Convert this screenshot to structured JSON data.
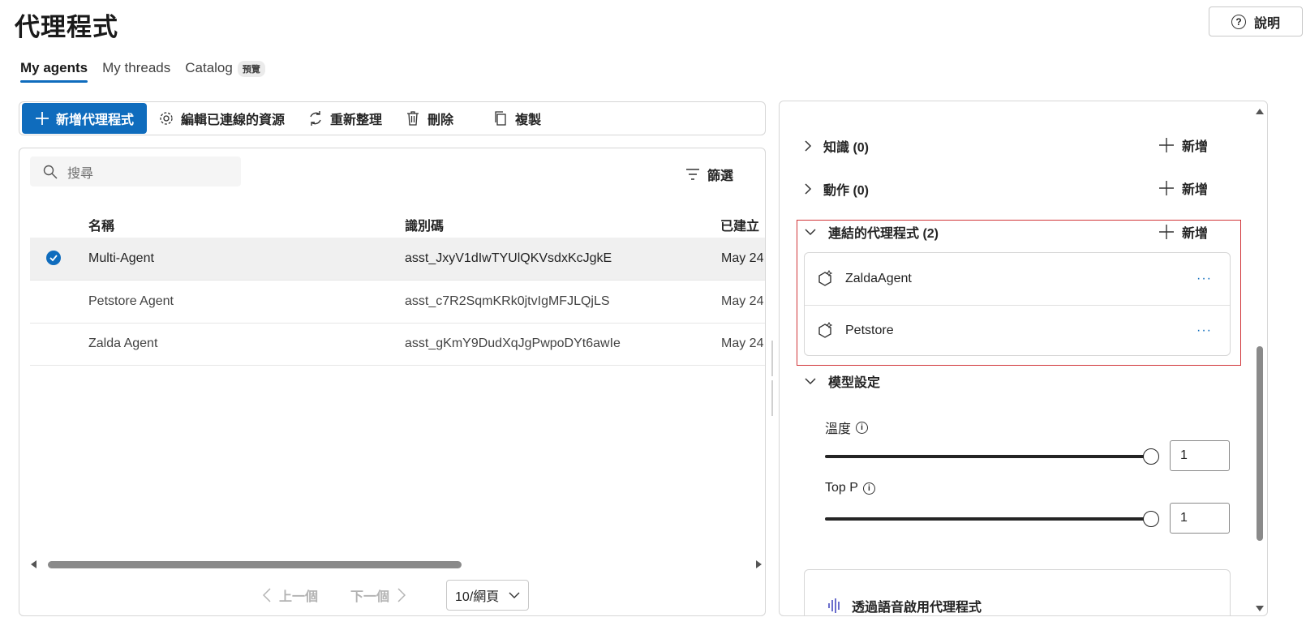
{
  "page": {
    "title": "代理程式",
    "help_label": "說明"
  },
  "tabs": [
    {
      "label": "My agents",
      "active": true
    },
    {
      "label": "My threads",
      "active": false
    },
    {
      "label": "Catalog",
      "active": false,
      "badge": "預覽"
    }
  ],
  "toolbar": {
    "new_agent": "新增代理程式",
    "edit_resources": "編輯已連線的資源",
    "refresh": "重新整理",
    "delete": "刪除",
    "copy": "複製"
  },
  "list": {
    "search_placeholder": "搜尋",
    "filter_label": "篩選",
    "columns": [
      "名稱",
      "識別碼",
      "已建立"
    ],
    "rows": [
      {
        "name": "Multi-Agent",
        "id": "asst_JxyV1dIwTYUlQKVsdxKcJgkE",
        "created": "May 24,",
        "selected": true
      },
      {
        "name": "Petstore Agent",
        "id": "asst_c7R2SqmKRk0jtvIgMFJLQjLS",
        "created": "May 24,",
        "selected": false
      },
      {
        "name": "Zalda Agent",
        "id": "asst_gKmY9DudXqJgPwpoDYt6awIe",
        "created": "May 24,",
        "selected": false
      }
    ],
    "pager": {
      "prev": "上一個",
      "next": "下一個",
      "page_size": "10/網頁"
    },
    "horizontal_scroll_position": 0.0
  },
  "details": {
    "knowledge": {
      "label": "知識 (0)",
      "add": "新增"
    },
    "actions": {
      "label": "動作 (0)",
      "add": "新增"
    },
    "connected_agents": {
      "label": "連結的代理程式 (2)",
      "add": "新增",
      "items": [
        {
          "name": "ZaldaAgent",
          "more": "···"
        },
        {
          "name": "Petstore",
          "more": "···"
        }
      ]
    },
    "model_settings": {
      "label": "模型設定",
      "temperature": {
        "label": "溫度",
        "value": "1",
        "slider_fraction": 1.0
      },
      "top_p": {
        "label": "Top P",
        "value": "1",
        "slider_fraction": 1.0
      }
    },
    "voice": {
      "label": "透過語音啟用代理程式"
    }
  },
  "colors": {
    "accent": "#0f6cbd",
    "highlight_border": "#d13438",
    "text": "#242424"
  }
}
